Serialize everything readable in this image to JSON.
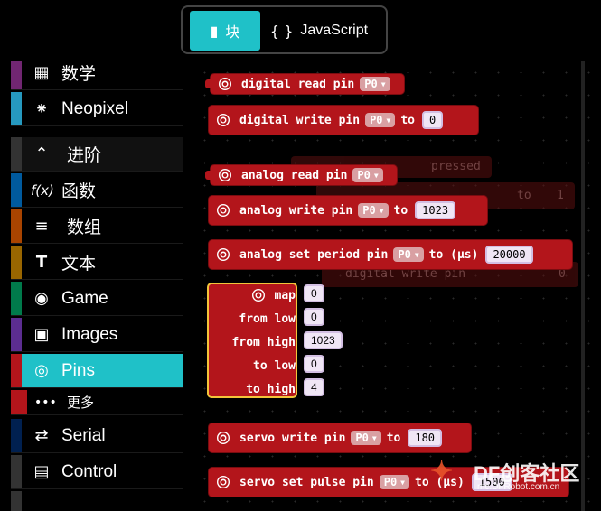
{
  "editor_toggle": {
    "blocks_label": "块",
    "javascript_label": "JavaScript",
    "blocks_icon": "puzzle-icon",
    "javascript_icon": "curly-braces-icon"
  },
  "toolbox": {
    "items": [
      {
        "label": "数学",
        "icon": "calculator-icon",
        "color": "#712672"
      },
      {
        "label": "Neopixel",
        "icon": "dots-circle-icon",
        "color": "#2699bf"
      },
      {
        "label": "进阶",
        "icon": "chevron-up-icon",
        "color": "#333333"
      },
      {
        "label": "函数",
        "icon": "function-icon",
        "color": "#005a9e"
      },
      {
        "label": "数组",
        "icon": "list-icon",
        "color": "#a94400"
      },
      {
        "label": "文本",
        "icon": "text-icon",
        "color": "#996600"
      },
      {
        "label": "Game",
        "icon": "gamepad-icon",
        "color": "#007a4b"
      },
      {
        "label": "Images",
        "icon": "image-icon",
        "color": "#5c2d91"
      },
      {
        "label": "Pins",
        "icon": "pin-circle-icon",
        "color": "#b3151b"
      },
      {
        "label": "更多",
        "icon": "ellipsis-icon",
        "color": "#b3151b"
      },
      {
        "label": "Serial",
        "icon": "usb-icon",
        "color": "#002050"
      },
      {
        "label": "Control",
        "icon": "control-icon",
        "color": "#333333"
      }
    ]
  },
  "blocks": {
    "digital_read": {
      "text": "digital read pin",
      "pin": "P0"
    },
    "digital_write": {
      "text": "digital write pin",
      "pin": "P0",
      "to": "to",
      "value": "0"
    },
    "analog_read": {
      "text": "analog read pin",
      "pin": "P0"
    },
    "analog_write": {
      "text": "analog write pin",
      "pin": "P0",
      "to": "to",
      "value": "1023"
    },
    "analog_period": {
      "text": "analog set period pin",
      "pin": "P0",
      "to": "to (µs)",
      "value": "20000"
    },
    "map": {
      "rows": [
        {
          "label": "map",
          "value": "0"
        },
        {
          "label": "from low",
          "value": "0"
        },
        {
          "label": "from high",
          "value": "1023"
        },
        {
          "label": "to low",
          "value": "0"
        },
        {
          "label": "to high",
          "value": "4"
        }
      ]
    },
    "servo_write": {
      "text": "servo write pin",
      "pin": "P0",
      "to": "to",
      "value": "180"
    },
    "servo_pulse": {
      "text": "servo set pulse pin",
      "pin": "P0",
      "to": "to (µs)",
      "value": "1500"
    }
  },
  "background_blocks": {
    "pressed": "pressed",
    "to": "to",
    "value": "1",
    "digital_write": "digital write pin",
    "value2": "0"
  },
  "watermark": {
    "text": "DF创客社区",
    "sub": "mc.DFRobot.com.cn"
  }
}
